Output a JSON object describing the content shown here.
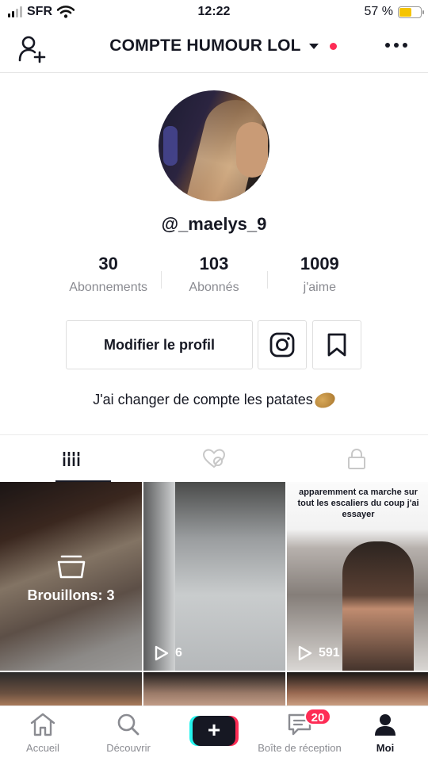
{
  "status_bar": {
    "carrier": "SFR",
    "time": "12:22",
    "battery": "57 %"
  },
  "header": {
    "account_name": "COMPTE HUMOUR LOL"
  },
  "profile": {
    "username": "@_maelys_9",
    "stats": [
      {
        "value": "30",
        "label": "Abonnements"
      },
      {
        "value": "103",
        "label": "Abonnés"
      },
      {
        "value": "1009",
        "label": "j'aime"
      }
    ],
    "edit_label": "Modifier le profil",
    "bio": "J'ai changer de compte les patates"
  },
  "grid": {
    "drafts_label": "Brouillons: 3",
    "videos": [
      {
        "views": "6"
      },
      {
        "views": "591",
        "caption": "apparemment ca marche sur tout les escaliers du coup j'ai essayer"
      }
    ]
  },
  "bottom_nav": {
    "items": [
      {
        "label": "Accueil",
        "icon": "home-icon"
      },
      {
        "label": "Découvrir",
        "icon": "search-icon"
      },
      {
        "label": "",
        "icon": "plus-icon"
      },
      {
        "label": "Boîte de réception",
        "icon": "inbox-icon",
        "badge": "20"
      },
      {
        "label": "Moi",
        "icon": "profile-icon"
      }
    ]
  },
  "colors": {
    "accent": "#fe2c55",
    "cyan": "#25f4ee",
    "text": "#161823",
    "muted": "#8a8b91"
  }
}
